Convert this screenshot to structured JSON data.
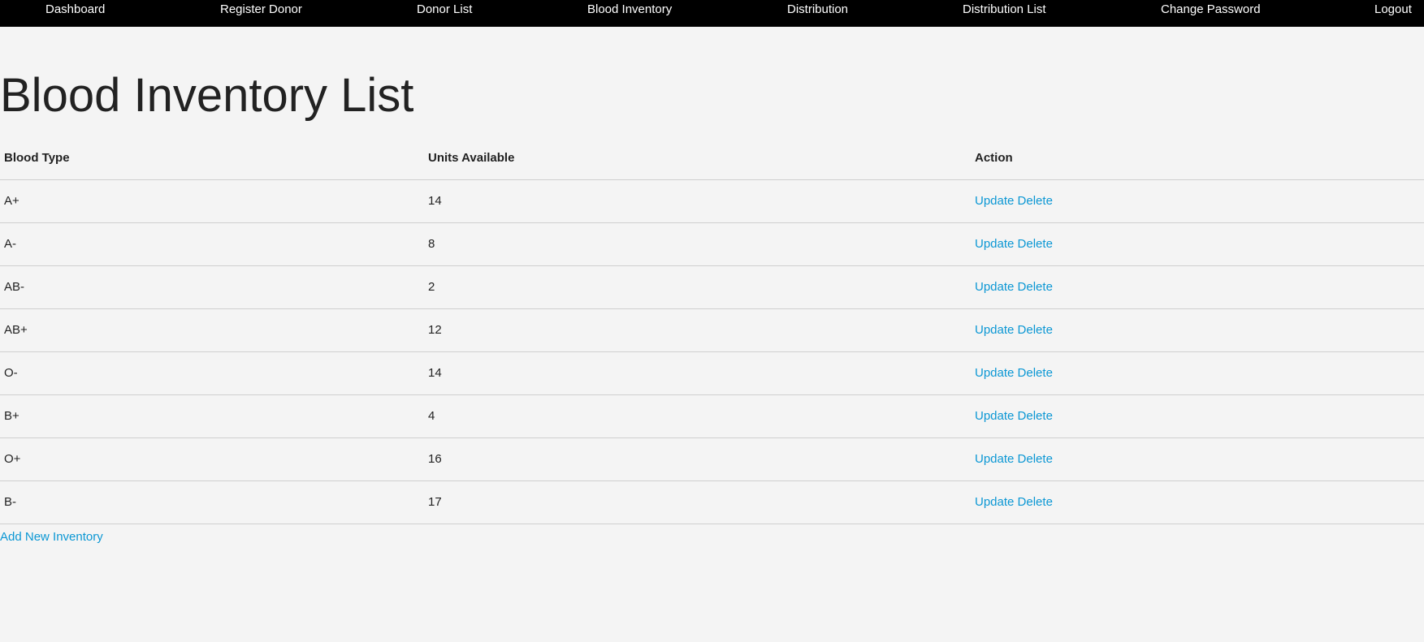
{
  "nav": {
    "items": [
      {
        "label": "Dashboard"
      },
      {
        "label": "Register Donor"
      },
      {
        "label": "Donor List"
      },
      {
        "label": "Blood Inventory"
      },
      {
        "label": "Distribution"
      },
      {
        "label": "Distribution List"
      },
      {
        "label": "Change Password"
      },
      {
        "label": "Logout"
      }
    ]
  },
  "page": {
    "title": "Blood Inventory List"
  },
  "table": {
    "headers": [
      "Blood Type",
      "Units Available",
      "Action"
    ],
    "rows": [
      {
        "blood_type": "A+",
        "units": "14",
        "update": "Update",
        "delete": "Delete"
      },
      {
        "blood_type": "A-",
        "units": "8",
        "update": "Update",
        "delete": "Delete"
      },
      {
        "blood_type": "AB-",
        "units": "2",
        "update": "Update",
        "delete": "Delete"
      },
      {
        "blood_type": "AB+",
        "units": "12",
        "update": "Update",
        "delete": "Delete"
      },
      {
        "blood_type": "O-",
        "units": "14",
        "update": "Update",
        "delete": "Delete"
      },
      {
        "blood_type": "B+",
        "units": "4",
        "update": "Update",
        "delete": "Delete"
      },
      {
        "blood_type": "O+",
        "units": "16",
        "update": "Update",
        "delete": "Delete"
      },
      {
        "blood_type": "B-",
        "units": "17",
        "update": "Update",
        "delete": "Delete"
      }
    ]
  },
  "add_link": "Add New Inventory",
  "colors": {
    "nav_bg": "#000000",
    "page_bg": "#f4f4f4",
    "link": "#0b97d4",
    "divider": "#cfcfcf"
  }
}
